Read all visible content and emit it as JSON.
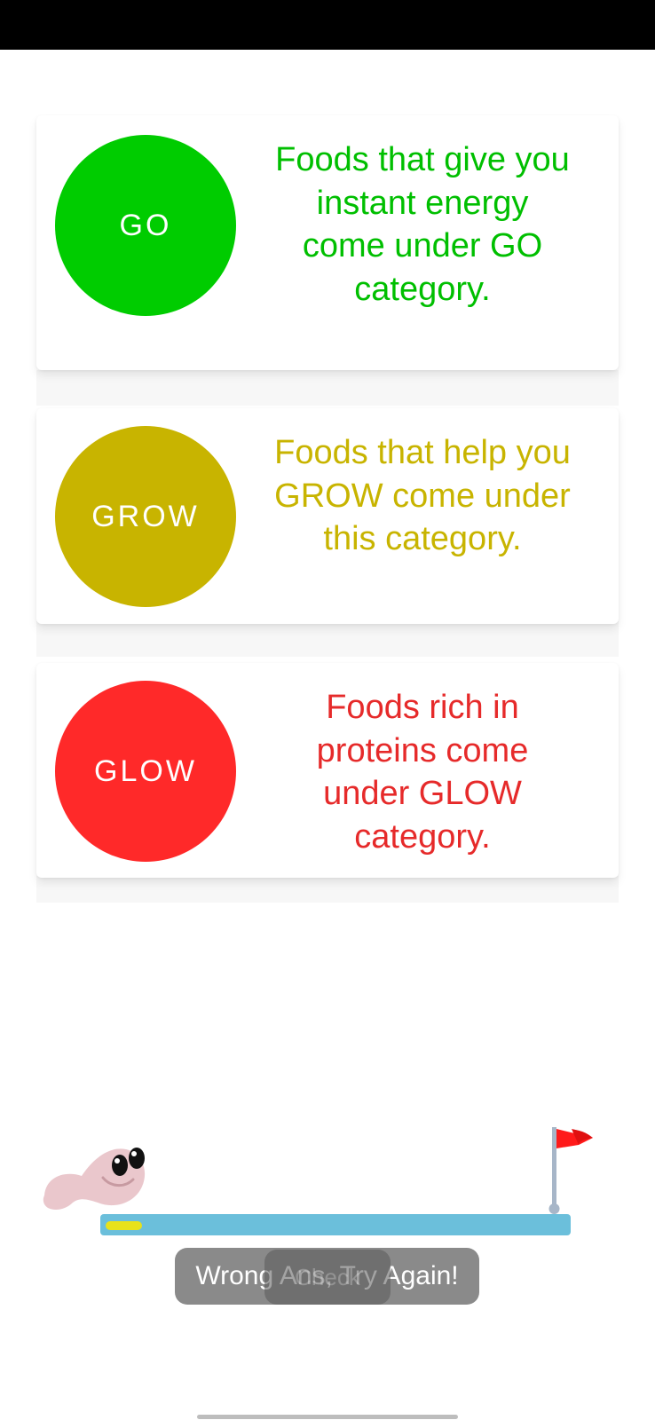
{
  "cards": [
    {
      "label": "GO",
      "description": "Foods that give you instant energy come under GO category.",
      "color": "#00cc00",
      "text_color": "#00bf00"
    },
    {
      "label": "GROW",
      "description": "Foods that help you GROW come under this category.",
      "color": "#c8b400",
      "text_color": "#c8b400"
    },
    {
      "label": "GLOW",
      "description": "Foods rich in proteins come under GLOW category.",
      "color": "#ff2929",
      "text_color": "#e62a2a"
    }
  ],
  "progress": {
    "fraction": 0.08,
    "track_color": "#6bbfdb",
    "fill_color": "#e8e21a"
  },
  "toast": {
    "message": "Wrong Ans, Try Again!"
  },
  "ghost_button": {
    "label": "Check"
  },
  "icons": {
    "mascot": "worm-mascot-icon",
    "goal": "red-flag-icon"
  }
}
